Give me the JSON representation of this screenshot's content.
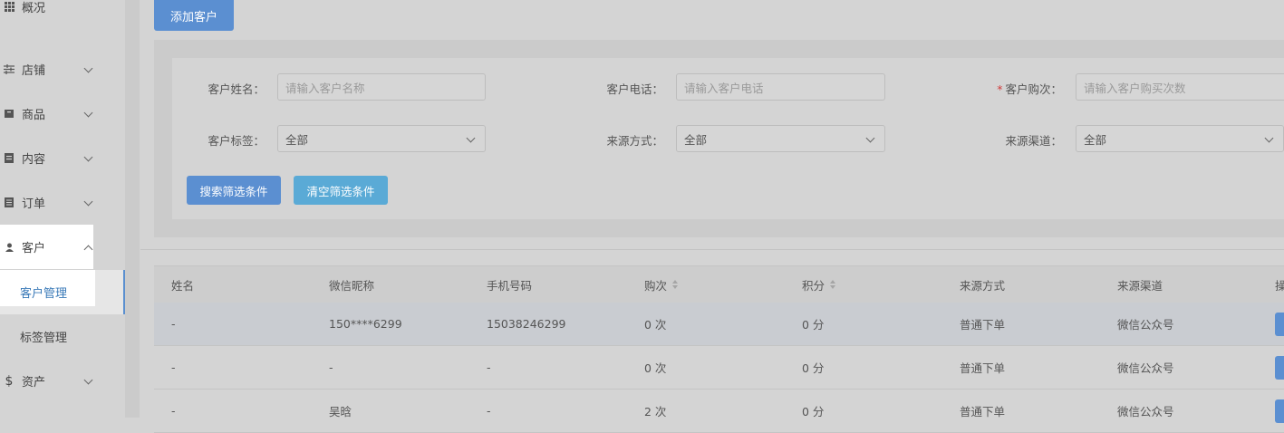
{
  "sidebar": {
    "items": [
      {
        "label": "概况",
        "icon": "grid-icon"
      },
      {
        "label": "店铺",
        "icon": "sliders-icon"
      },
      {
        "label": "商品",
        "icon": "box-icon"
      },
      {
        "label": "内容",
        "icon": "document-icon"
      },
      {
        "label": "订单",
        "icon": "list-icon"
      },
      {
        "label": "客户",
        "icon": "user-icon"
      },
      {
        "label": "资产",
        "icon": "dollar-icon"
      }
    ],
    "sub_items": [
      {
        "label": "客户管理"
      },
      {
        "label": "标签管理"
      }
    ]
  },
  "toolbar": {
    "add_label": "添加客户"
  },
  "filters": {
    "name_label": "客户姓名：",
    "name_placeholder": "请输入客户名称",
    "phone_label": "客户电话：",
    "phone_placeholder": "请输入客户电话",
    "count_required": "*",
    "count_label": "客户购次：",
    "count_placeholder": "请输入客户购买次数",
    "tag_label": "客户标签：",
    "tag_value": "全部",
    "source_label": "来源方式：",
    "source_value": "全部",
    "channel_label": "来源渠道：",
    "channel_value": "全部",
    "search_label": "搜索筛选条件",
    "clear_label": "清空筛选条件"
  },
  "table": {
    "headers": [
      "姓名",
      "微信昵称",
      "手机号码",
      "购次",
      "积分",
      "来源方式",
      "来源渠道",
      "操"
    ],
    "rows": [
      [
        "-",
        "150****6299",
        "15038246299",
        "0 次",
        "0 分",
        "普通下单",
        "微信公众号"
      ],
      [
        "-",
        "-",
        "-",
        "0 次",
        "0 分",
        "普通下单",
        "微信公众号"
      ],
      [
        "-",
        "吴晗",
        "-",
        "2 次",
        "0 分",
        "普通下单",
        "微信公众号"
      ]
    ]
  },
  "colors": {
    "primary": "#5b8fd1",
    "secondary": "#5aaad6",
    "required": "#d13c3c",
    "active_text": "#3a7ab8"
  }
}
